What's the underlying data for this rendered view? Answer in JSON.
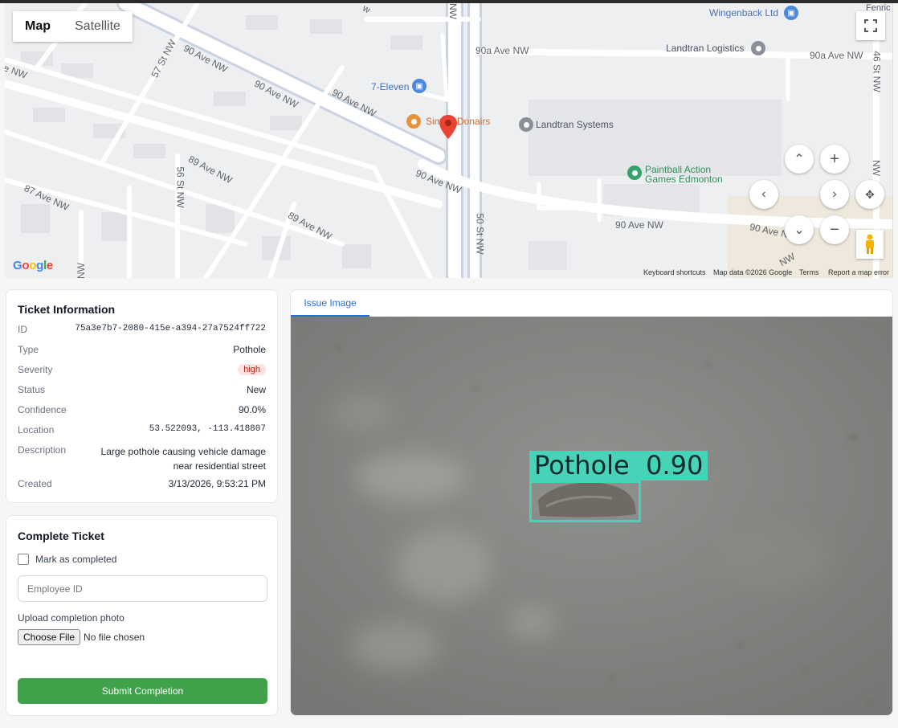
{
  "map": {
    "type_tabs": [
      "Map",
      "Satellite"
    ],
    "places": {
      "wingenback": "Wingenback Ltd",
      "fenrir": "Fenric",
      "landtran_logistics": "Landtran Logistics",
      "seven_eleven": "7-Eleven",
      "simply_donairs_a": "Sim",
      "simply_donairs_b": "Donairs",
      "landtran_systems": "Landtran Systems",
      "paintball_1": "Paintball Action",
      "paintball_2": "Games Edmonton"
    },
    "streets": {
      "ave90_a": "90 Ave NW",
      "ave90_top": "90a Ave NW",
      "ave90_top_r": "90a Ave NW",
      "ave89": "89 Ave NW",
      "ave89_b": "89 Ave NW",
      "ave87": "87 Ave NW",
      "st57": "57 St NW",
      "st56": "56 St NW",
      "st50": "50 St NW",
      "st46": "46 St NW",
      "ave90_b": "90 Ave NW",
      "ave90_c": "90 Ave NW",
      "ave90_d": "90 Ave NW",
      "ave90_e": "90 Ave N",
      "ave_nw_left": "e NW",
      "nw_top": "NW",
      "nw_bottom": "NW",
      "nw_right": "NW",
      "nw_corner": "NW",
      "aw_top": "w"
    },
    "logo": "Google",
    "footer": [
      "Keyboard shortcuts",
      "Map data ©2026 Google",
      "Terms",
      "Report a map error"
    ]
  },
  "ticket": {
    "title": "Ticket Information",
    "fields": [
      {
        "label": "ID",
        "value": "75a3e7b7-2080-415e-a394-27a7524ff722"
      },
      {
        "label": "Type",
        "value": "Pothole"
      },
      {
        "label": "Severity",
        "value": "high"
      },
      {
        "label": "Status",
        "value": "New"
      },
      {
        "label": "Confidence",
        "value": "90.0%"
      },
      {
        "label": "Location",
        "value": "53.522093, -113.418807"
      },
      {
        "label": "Description",
        "value": "Large pothole causing vehicle damage near residential street"
      },
      {
        "label": "Created",
        "value": "3/13/2026, 9:53:21 PM"
      }
    ]
  },
  "complete": {
    "title": "Complete Ticket",
    "checkbox_label": "Mark as completed",
    "employee_placeholder": "Employee ID",
    "upload_label": "Upload completion photo",
    "choose_file": "Choose File",
    "no_file": "No file chosen",
    "submit": "Submit Completion"
  },
  "issue": {
    "tab": "Issue Image",
    "detection_label": "Pothole  0.90"
  },
  "colors": {
    "accent": "#2b6cd9",
    "submit_green": "#3fa24b",
    "severity_bg": "#fde2e2",
    "severity_text": "#b42318",
    "detection": "#46d3b8",
    "marker_red": "#ea4335"
  }
}
